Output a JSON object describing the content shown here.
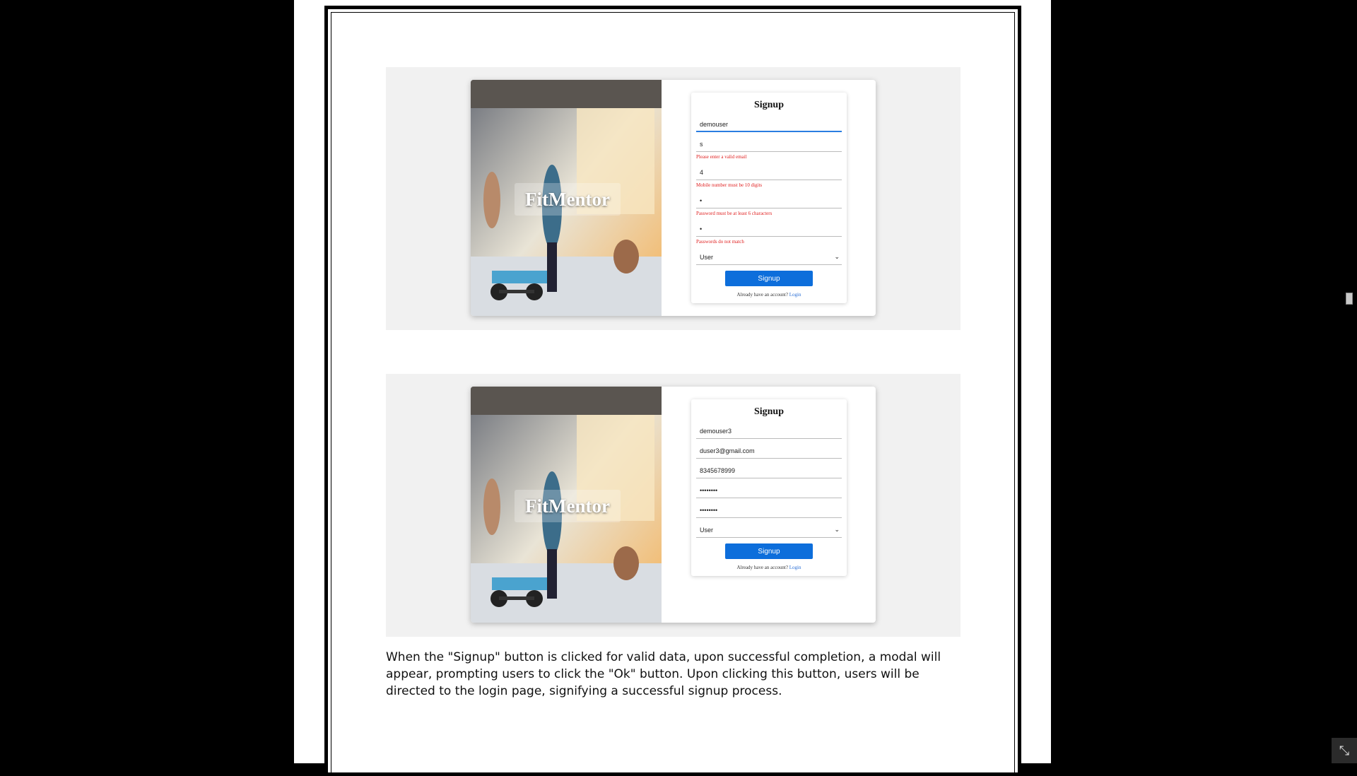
{
  "screenshot1": {
    "brand": "FitMentor",
    "form_title": "Signup",
    "username_value": "demouser",
    "email_value": "s",
    "email_error": "Please enter a valid email",
    "mobile_value": "4",
    "mobile_error": "Mobile number must be 10 digits",
    "password_value": "•",
    "password_error": "Password must be at least 6 characters",
    "confirm_value": "•",
    "confirm_error": "Passwords do not match",
    "role_value": "User",
    "button_label": "Signup",
    "login_prompt": "Already have an account?",
    "login_link": "Login"
  },
  "screenshot2": {
    "brand": "FitMentor",
    "form_title": "Signup",
    "username_value": "demouser3",
    "email_value": "duser3@gmail.com",
    "mobile_value": "8345678999",
    "password_value": "••••••••",
    "confirm_value": "••••••••",
    "role_value": "User",
    "button_label": "Signup",
    "login_prompt": "Already have an account?",
    "login_link": "Login"
  },
  "paragraph": "When the \"Signup\" button is clicked for valid data, upon successful completion, a modal will appear, prompting users to click the \"Ok\" button. Upon clicking this button, users will be directed to the login page, signifying a successful signup process.",
  "icons": {
    "chevron": "⌄",
    "exit_fullscreen": "⤡"
  }
}
